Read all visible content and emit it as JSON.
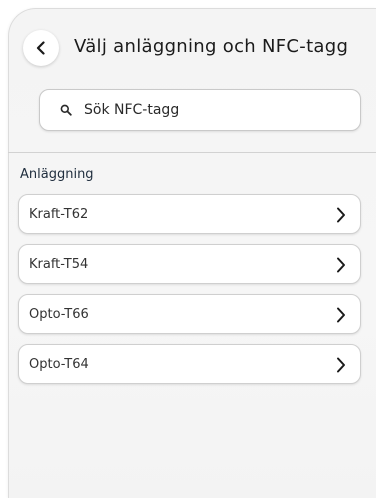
{
  "header": {
    "title": "Välj anläggning och NFC-tagg",
    "back_icon": "chevron-left-icon"
  },
  "search": {
    "placeholder": "Sök NFC-tagg",
    "value": "",
    "icon": "search-icon"
  },
  "section": {
    "label": "Anläggning"
  },
  "facilities": [
    {
      "label": "Kraft-T62"
    },
    {
      "label": "Kraft-T54"
    },
    {
      "label": "Opto-T66"
    },
    {
      "label": "Opto-T64"
    }
  ],
  "colors": {
    "background": "#f4f4f4",
    "card": "#ffffff",
    "border": "#cfcfcf",
    "text": "#1b1b1b",
    "section_label": "#1f2d3d"
  }
}
